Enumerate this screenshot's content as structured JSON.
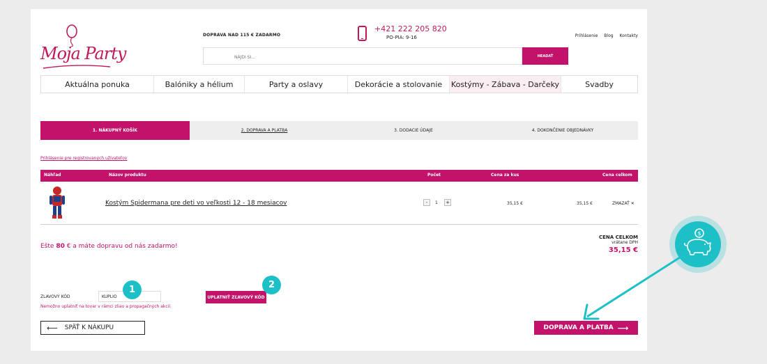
{
  "header": {
    "logo_text": "Moja Party",
    "free_shipping": "DOPRAVA NAD 115 € ZADARMO",
    "phone": "+421 222 205 820",
    "hours": "PO-PIA: 9-16",
    "links": [
      "Prihlásenie",
      "Blog",
      "Kontakty"
    ],
    "search_placeholder": "NÁJDI SI...",
    "search_button": "HEADAŤ"
  },
  "nav": [
    "Aktuálna ponuka",
    "Balóniky a hélium",
    "Party a oslavy",
    "Dekorácie a stolovanie",
    "Kostýmy - Zábava - Darčeky",
    "Svadby"
  ],
  "steps": [
    "1. NÁKUPNÝ KOŠÍK",
    "2. DOPRAVA A PLATBA",
    "3. DODACIE ÚDAJE",
    "4. DOKONČENIE OBJEDNÁVKY"
  ],
  "login_registered": "Prihlásenie pre registrovaných užívateľov",
  "table": {
    "headers": [
      "Náhľad",
      "Názov produktu",
      "Počet",
      "Cena za kus",
      "Cena celkom"
    ],
    "rows": [
      {
        "name": "Kostým Spidermana pre deti vo veľkosti 12 - 18 mesiacov",
        "qty": "1",
        "unit_price": "35,15 €",
        "total_price": "35,15 €",
        "remove": "ZMAZAŤ ✕"
      }
    ]
  },
  "total": {
    "label": "CENA CELKOM",
    "vat": "vrátane DPH",
    "value": "35,15 €"
  },
  "free_shipping_msg": {
    "prefix": "Ešte ",
    "amount": "80",
    "suffix": " € a máte dopravu od nás zadarmo!"
  },
  "coupon": {
    "label": "ZLAVOVÝ KÓD",
    "value": "KUPLIO",
    "button": "UPLATNIŤ ZĽAVOVÝ KÓD",
    "error": "Nemožno uplatniť na tovar v rámci zliav a propagačných akcií."
  },
  "back_button": "SPÄŤ K NÁKUPU",
  "next_button": "DOPRAVA A PLATBA",
  "badges": [
    "1",
    "2"
  ],
  "colors": {
    "brand": "#c2126a",
    "accent_teal": "#1ec0c8"
  }
}
